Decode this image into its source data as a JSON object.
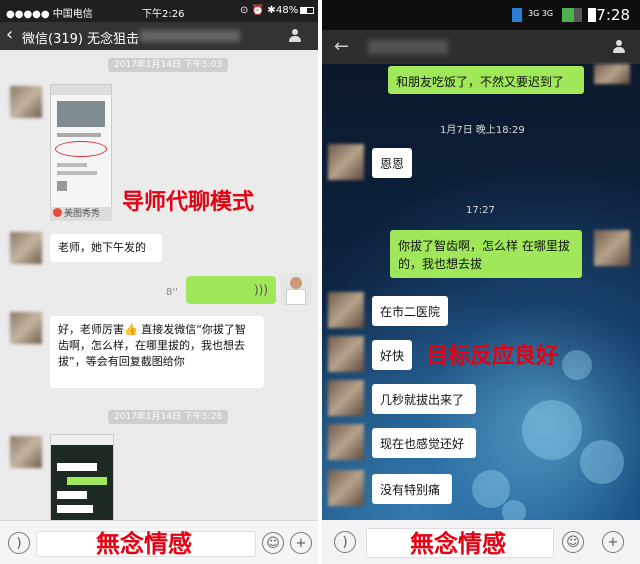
{
  "left": {
    "status": {
      "carrier": "●●●●● 中国电信",
      "time": "下午2:26",
      "battery": "48%"
    },
    "header": {
      "back_glyph": "‹",
      "title": "微信(319)  无念狙击"
    },
    "messages": {
      "ts1": "2017年1月14日 下午5:03",
      "img_caption": "美图秀秀",
      "msg1": "老师，她下午发的",
      "voice_duration": "8''",
      "msg2": "好，老师厉害👍 直接发微信“你拔了智齿啊，怎么样，在哪里拔的，我也想去拔”，等会有回复截图给你",
      "ts2": "2017年1月14日 下午5:28"
    },
    "overlay_label": "导师代聊模式",
    "watermark": "無念情感"
  },
  "right": {
    "status": {
      "network": "3G 3G",
      "time": "17:28"
    },
    "header": {
      "back_glyph": "←"
    },
    "messages": {
      "msg1": "和朋友吃饭了，不然又要迟到了",
      "ts1": "1月7日 晚上18:29",
      "msg2": "恩恩",
      "ts2": "17:27",
      "msg3": "你拔了智齿啊，怎么样 在哪里拔的，我也想去拔",
      "msg4": "在市二医院",
      "msg5": "好快",
      "msg6": "几秒就拔出来了",
      "msg7": "现在也感觉还好",
      "msg8": "没有特别痛"
    },
    "overlay_label": "目标反应良好",
    "watermark": "無念情感"
  },
  "icons": {
    "voice": "voice-icon",
    "emoji": "emoji-icon",
    "plus": "plus-icon",
    "profile": "person-icon"
  },
  "colors": {
    "bubble_green": "#a0e75a",
    "overlay_red": "#e60012",
    "wechat_header": "#333333"
  }
}
